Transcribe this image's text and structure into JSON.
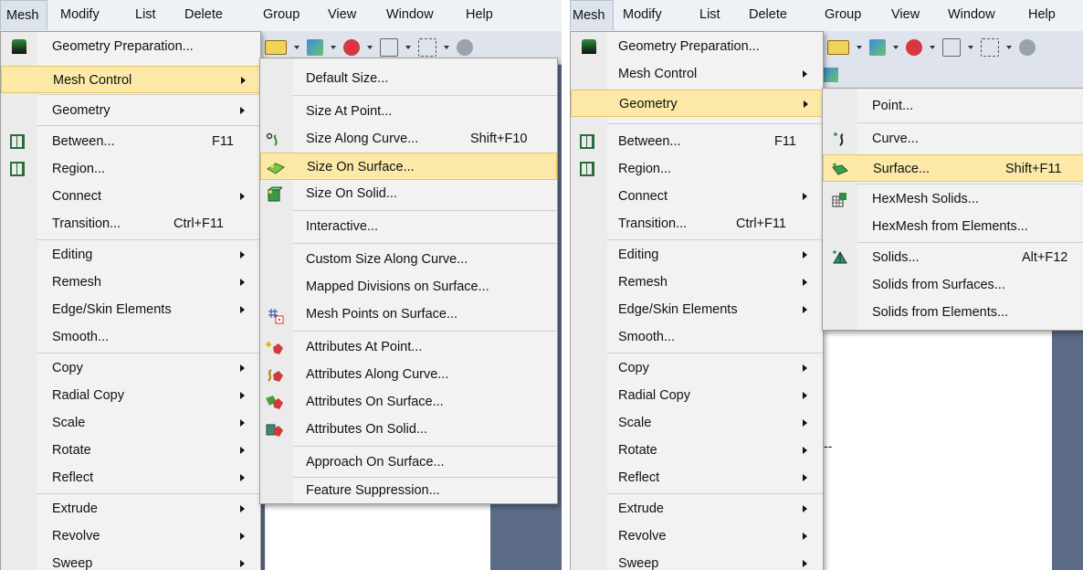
{
  "menubar": [
    "Mesh",
    "Modify",
    "List",
    "Delete",
    "Group",
    "View",
    "Window",
    "Help"
  ],
  "mesh_menu": {
    "items": [
      {
        "label": "Geometry Preparation...",
        "icon": "geometry-prep-icon"
      },
      {
        "label": "Mesh Control",
        "submenu": true
      },
      {
        "label": "Geometry",
        "submenu": true
      },
      {
        "label": "Between...",
        "shortcut": "F11",
        "icon": "grid-icon"
      },
      {
        "label": "Region...",
        "icon": "grid-icon"
      },
      {
        "label": "Connect",
        "submenu": true
      },
      {
        "label": "Transition...",
        "shortcut": "Ctrl+F11"
      },
      {
        "label": "Editing",
        "submenu": true
      },
      {
        "label": "Remesh",
        "submenu": true
      },
      {
        "label": "Edge/Skin Elements",
        "submenu": true
      },
      {
        "label": "Smooth..."
      },
      {
        "label": "Copy",
        "submenu": true
      },
      {
        "label": "Radial Copy",
        "submenu": true
      },
      {
        "label": "Scale",
        "submenu": true
      },
      {
        "label": "Rotate",
        "submenu": true
      },
      {
        "label": "Reflect",
        "submenu": true
      },
      {
        "label": "Extrude",
        "submenu": true
      },
      {
        "label": "Revolve",
        "submenu": true
      },
      {
        "label": "Sweep",
        "submenu": true
      }
    ]
  },
  "mesh_control_submenu": {
    "items": [
      {
        "label": "Default Size..."
      },
      {
        "label": "Size At Point..."
      },
      {
        "label": "Size Along Curve...",
        "shortcut": "Shift+F10",
        "icon": "size-along-curve-icon"
      },
      {
        "label": "Size On Surface...",
        "icon": "size-on-surface-icon"
      },
      {
        "label": "Size On Solid...",
        "icon": "size-on-solid-icon"
      },
      {
        "label": "Interactive..."
      },
      {
        "label": "Custom Size Along Curve..."
      },
      {
        "label": "Mapped Divisions on Surface..."
      },
      {
        "label": "Mesh Points on Surface...",
        "icon": "mesh-points-icon"
      },
      {
        "label": "Attributes At Point...",
        "icon": "attributes-point-icon"
      },
      {
        "label": "Attributes Along Curve...",
        "icon": "attributes-curve-icon"
      },
      {
        "label": "Attributes On Surface...",
        "icon": "attributes-surface-icon"
      },
      {
        "label": "Attributes On Solid...",
        "icon": "attributes-solid-icon"
      },
      {
        "label": "Approach On Surface..."
      },
      {
        "label": "Feature Suppression..."
      }
    ]
  },
  "geometry_submenu": {
    "items": [
      {
        "label": "Point..."
      },
      {
        "label": "Curve...",
        "icon": "curve-icon"
      },
      {
        "label": "Surface...",
        "shortcut": "Shift+F11",
        "icon": "surface-icon"
      },
      {
        "label": "HexMesh Solids...",
        "icon": "hexmesh-icon"
      },
      {
        "label": "HexMesh from Elements..."
      },
      {
        "label": "Solids...",
        "shortcut": "Alt+F12",
        "icon": "solids-icon"
      },
      {
        "label": "Solids from Surfaces..."
      },
      {
        "label": "Solids from Elements..."
      }
    ]
  },
  "canvas_text": "--",
  "colors": {
    "highlight": "#fce9a8",
    "highlight_border": "#e7c462",
    "menu_bg": "#f2f2f2",
    "menubar_bg": "#eef1f6"
  }
}
